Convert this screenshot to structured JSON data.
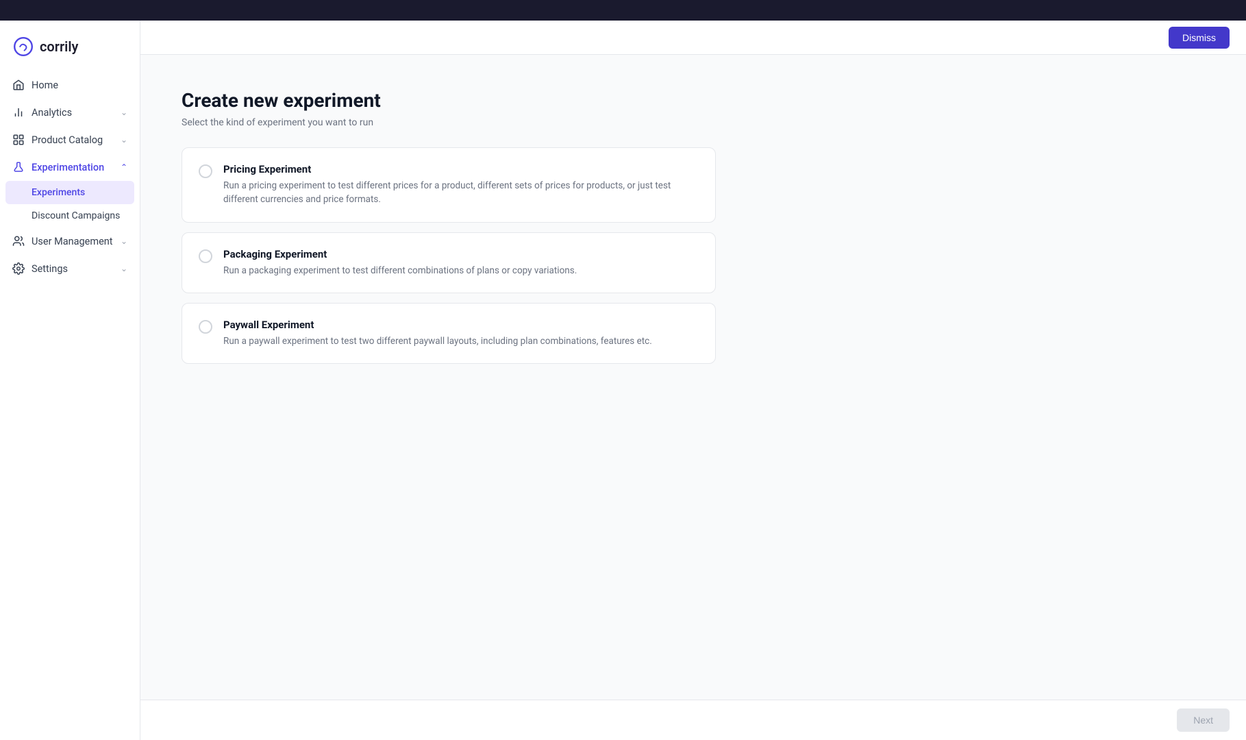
{
  "topbar": {},
  "logo": {
    "text": "corrily"
  },
  "nav": {
    "items": [
      {
        "id": "home",
        "label": "Home",
        "icon": "home",
        "active": false,
        "expandable": false
      },
      {
        "id": "analytics",
        "label": "Analytics",
        "icon": "analytics",
        "active": false,
        "expandable": true
      },
      {
        "id": "product-catalog",
        "label": "Product Catalog",
        "icon": "product",
        "active": false,
        "expandable": true
      },
      {
        "id": "experimentation",
        "label": "Experimentation",
        "icon": "experiment",
        "active": true,
        "expandable": true,
        "expanded": true
      },
      {
        "id": "user-management",
        "label": "User Management",
        "icon": "user",
        "active": false,
        "expandable": true
      },
      {
        "id": "settings",
        "label": "Settings",
        "icon": "settings",
        "active": false,
        "expandable": true
      }
    ],
    "sub_items": {
      "experimentation": [
        {
          "id": "experiments",
          "label": "Experiments",
          "active": true
        },
        {
          "id": "discount-campaigns",
          "label": "Discount Campaigns",
          "active": false
        }
      ]
    }
  },
  "header": {
    "dismiss_label": "Dismiss"
  },
  "page": {
    "title": "Create new experiment",
    "subtitle": "Select the kind of experiment you want to run"
  },
  "experiment_options": [
    {
      "id": "pricing",
      "title": "Pricing Experiment",
      "description": "Run a pricing experiment to test different prices for a product, different sets of prices for products, or just test different currencies and price formats.",
      "selected": false
    },
    {
      "id": "packaging",
      "title": "Packaging Experiment",
      "description": "Run a packaging experiment to test different combinations of plans or copy variations.",
      "selected": false
    },
    {
      "id": "paywall",
      "title": "Paywall Experiment",
      "description": "Run a paywall experiment to test two different paywall layouts, including plan combinations, features etc.",
      "selected": false
    }
  ],
  "footer": {
    "next_label": "Next"
  }
}
